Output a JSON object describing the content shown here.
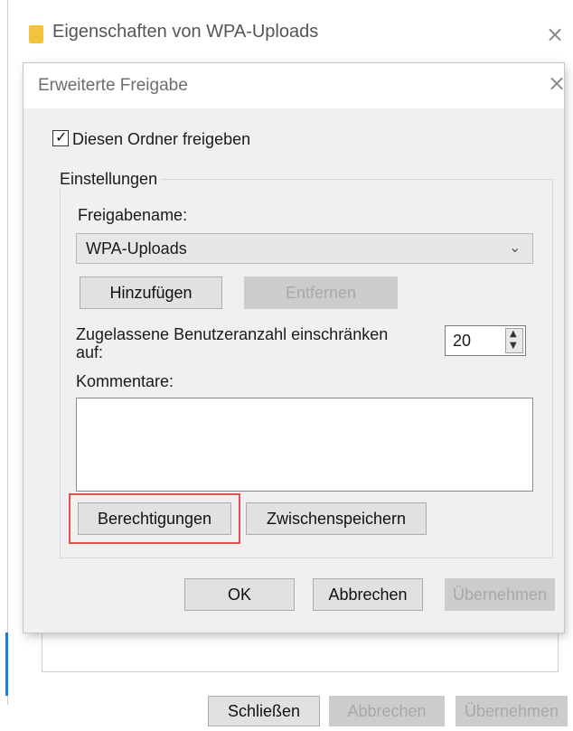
{
  "outer_window": {
    "title": "Eigenschaften von WPA-Uploads",
    "buttons": {
      "close_label": "Schließen",
      "cancel_label": "Abbrechen",
      "apply_label": "Übernehmen"
    }
  },
  "dialog": {
    "title": "Erweiterte Freigabe",
    "share_checkbox": {
      "label": "Diesen Ordner freigeben",
      "checked": true
    },
    "settings_group": {
      "legend": "Einstellungen",
      "sharename_label": "Freigabename:",
      "sharename_value": "WPA-Uploads",
      "add_label": "Hinzufügen",
      "remove_label": "Entfernen",
      "limit_label": "Zugelassene Benutzeranzahl einschränken auf:",
      "limit_value": "20",
      "comments_label": "Kommentare:",
      "comments_value": "",
      "permissions_label": "Berechtigungen",
      "cache_label": "Zwischenspeichern"
    },
    "buttons": {
      "ok_label": "OK",
      "cancel_label": "Abbrechen",
      "apply_label": "Übernehmen"
    }
  },
  "colors": {
    "highlight": "#e0524a",
    "folder": "#f2c43b",
    "window_accent": "#2b78c5"
  },
  "icons": {
    "outer_close": "×",
    "dialog_close": "×",
    "checkmark": "✓",
    "chevron": "⌄",
    "spin_up": "▲",
    "spin_down": "▼"
  }
}
